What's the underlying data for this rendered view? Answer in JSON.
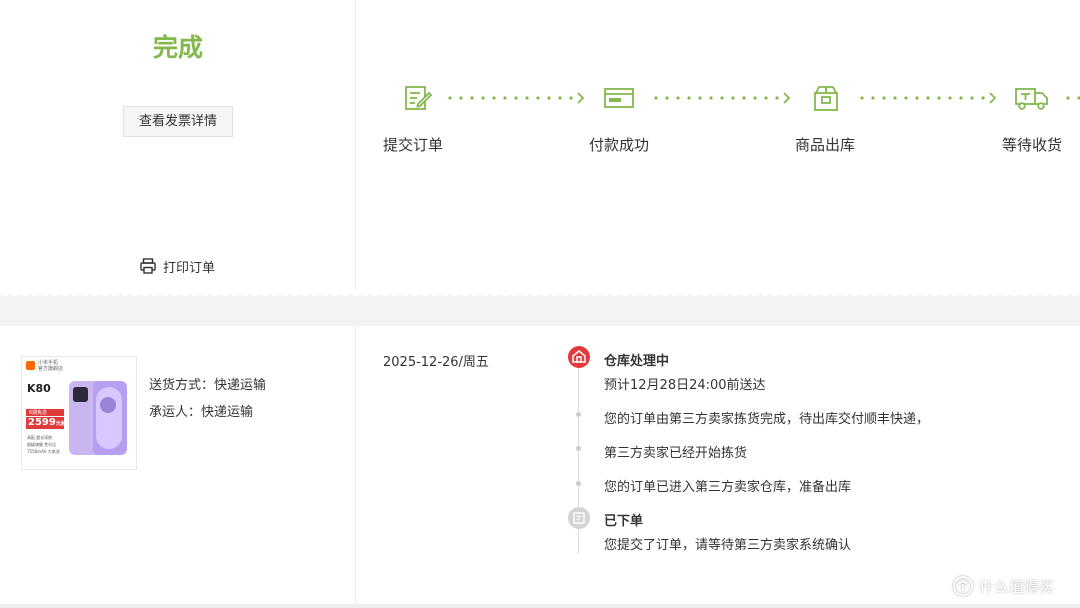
{
  "order_status": {
    "title": "完成",
    "invoice_button": "查看发票详情",
    "print_label": "打印订单",
    "accent_color": "#83b84c"
  },
  "steps": [
    {
      "label": "提交订单",
      "icon": "edit-document-icon"
    },
    {
      "label": "付款成功",
      "icon": "payment-card-icon"
    },
    {
      "label": "商品出库",
      "icon": "package-box-icon"
    },
    {
      "label": "等待收货",
      "icon": "delivery-truck-icon"
    }
  ],
  "product": {
    "thumbnail": {
      "brand_line1": "小米手机",
      "brand_line2": "官方旗舰店",
      "model": "K80",
      "badge": "6期免息",
      "price": "2599",
      "price_suffix": "元起",
      "notes": [
        "高配 超长续航",
        "超级旗舰 性价比",
        "7550mAh 大电池"
      ]
    },
    "shipping_method": "送货方式：快递运输",
    "carrier": "承运人：快递运输"
  },
  "tracking": {
    "date": "2025-12-26/周五",
    "events": [
      {
        "text": "仓库处理中",
        "type": "status-current"
      },
      {
        "text": "预计12月28日24:00前送达",
        "type": "detail"
      },
      {
        "text": "您的订单由第三方卖家拣货完成，待出库交付顺丰快递，",
        "type": "event"
      },
      {
        "text": "第三方卖家已经开始拣货",
        "type": "event"
      },
      {
        "text": "您的订单已进入第三方卖家仓库，准备出库",
        "type": "event"
      },
      {
        "text": "已下单",
        "type": "status-past"
      },
      {
        "text": "您提交了订单，请等待第三方卖家系统确认",
        "type": "detail"
      }
    ],
    "current_color": "#e4393c",
    "past_color": "#cccccc"
  },
  "watermark": {
    "text": "什么值得买",
    "icon": "smzdm-logo-icon"
  }
}
